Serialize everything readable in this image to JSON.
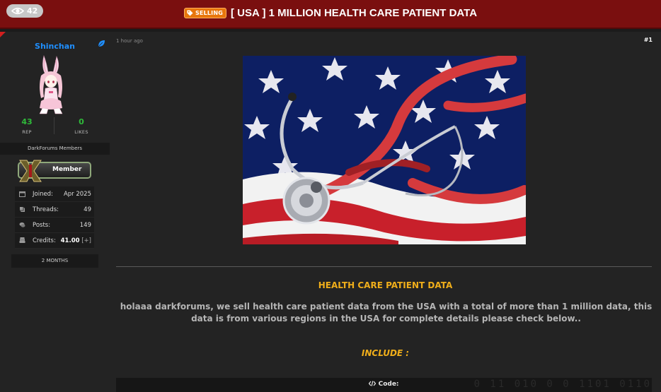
{
  "header": {
    "views_count": "42",
    "prefix_label": "SELLING",
    "title": "[ USA ] 1 MILLION HEALTH CARE PATIENT DATA"
  },
  "author": {
    "username": "Shinchan",
    "rep_value": "43",
    "rep_label": "REP",
    "likes_value": "0",
    "likes_label": "LIKES",
    "group": "DarkForums Members",
    "rank": "Member",
    "info": [
      {
        "label": "Joined:",
        "value": "Apr 2025",
        "icon": "calendar-icon"
      },
      {
        "label": "Threads:",
        "value": "49",
        "icon": "book-icon"
      },
      {
        "label": "Posts:",
        "value": "149",
        "icon": "chat-icon"
      },
      {
        "label": "Credits:",
        "value": "41.00",
        "extra": "[+]",
        "icon": "money-icon"
      }
    ],
    "membership": "2 MONTHS"
  },
  "post": {
    "time": "1 hour ago",
    "number": "#1",
    "heading": "HEALTH CARE PATIENT DATA",
    "body": "holaaa darkforums, we sell health care patient data from the USA with a total of more than 1 million data, this data is from various regions in the USA for complete details please check below..",
    "include": "INCLUDE :",
    "code_label": "Code:",
    "image_subject": "stethoscope-on-us-flag"
  },
  "colors": {
    "header_bg": "#7a0f0f",
    "username": "#1f8fff",
    "stat_green": "#2fba3a",
    "accent_gold": "#f0ae1a",
    "prefix_orange": "#e8760c"
  }
}
